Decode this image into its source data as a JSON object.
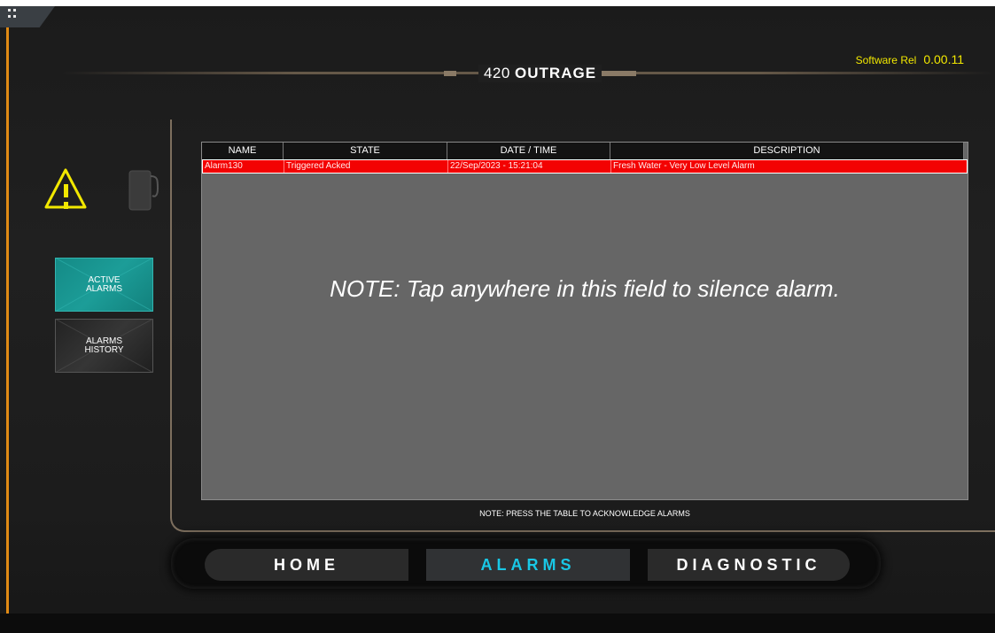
{
  "header": {
    "title_number": "420",
    "title_name": "OUTRAGE",
    "software_label": "Software Rel",
    "software_version": "0.00.11"
  },
  "sidebar": {
    "warning_icon": "warning-triangle-icon",
    "pump_icon": "pump-icon",
    "buttons": [
      {
        "label": "ACTIVE\nALARMS",
        "active": true
      },
      {
        "label": "ALARMS\nHISTORY",
        "active": false
      }
    ]
  },
  "alarm_table": {
    "columns": [
      "NAME",
      "STATE",
      "DATE / TIME",
      "DESCRIPTION"
    ],
    "rows": [
      {
        "name": "Alarm130",
        "state": "Triggered Acked",
        "datetime": "22/Sep/2023 - 15:21:04",
        "description": "Fresh Water - Very Low Level Alarm",
        "color": "#f30202"
      }
    ],
    "overlay_note": "NOTE: Tap anywhere in this field to silence alarm.",
    "footer_note": "NOTE: PRESS THE TABLE TO ACKNOWLEDGE ALARMS"
  },
  "nav": {
    "items": [
      {
        "label": "HOME",
        "active": false
      },
      {
        "label": "ALARMS",
        "active": true
      },
      {
        "label": "DIAGNOSTIC",
        "active": false
      }
    ],
    "active_color": "#19c8e6"
  },
  "colors": {
    "accent_orange": "#e08a14",
    "software_text": "#f2e800",
    "alarm_row": "#f30202",
    "active_button": "#1c9d98"
  }
}
